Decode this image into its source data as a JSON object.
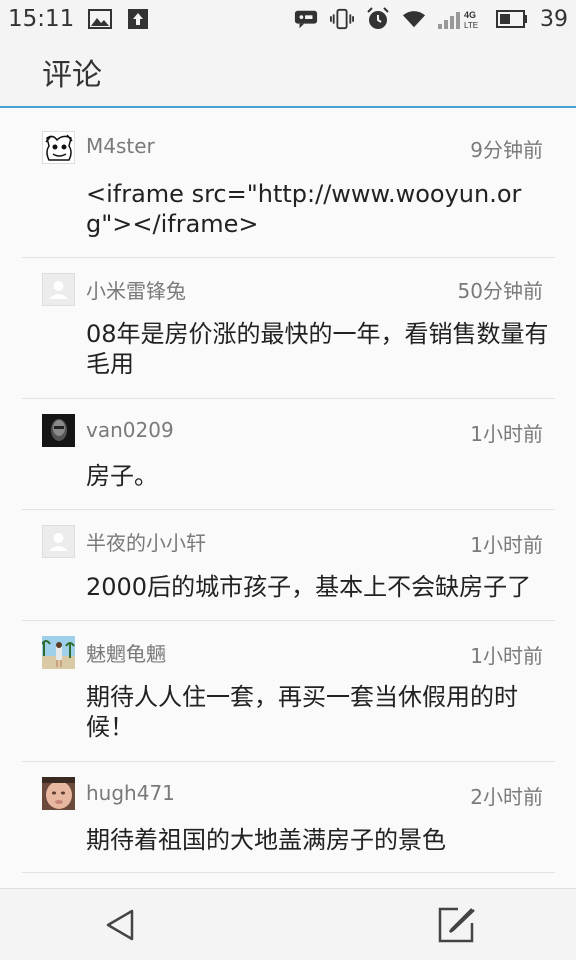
{
  "status_bar": {
    "time": "15:11",
    "battery_level": "39",
    "network": "4G LTE",
    "icons": [
      "image-icon",
      "upload-icon",
      "message-icon",
      "vibrate-icon",
      "alarm-icon",
      "wifi-icon",
      "signal-icon",
      "battery-icon"
    ]
  },
  "header": {
    "title": "评论"
  },
  "comments": [
    {
      "user": "M4ster",
      "time": "9分钟前",
      "text": "<iframe src=\"http://www.wooyun.org\"></iframe>",
      "avatar": "sketch-avatar"
    },
    {
      "user": "小米雷锋兔",
      "time": "50分钟前",
      "text": "08年是房价涨的最快的一年，看销售数量有毛用",
      "avatar": "default-avatar"
    },
    {
      "user": "van0209",
      "time": "1小时前",
      "text": "房子。",
      "avatar": "dark-portrait-avatar"
    },
    {
      "user": "半夜的小小轩",
      "time": "1小时前",
      "text": "2000后的城市孩子，基本上不会缺房子了",
      "avatar": "default-avatar"
    },
    {
      "user": "魅魍龟魎",
      "time": "1小时前",
      "text": "期待人人住一套，再买一套当休假用的时候！",
      "avatar": "beach-photo-avatar"
    },
    {
      "user": "hugh471",
      "time": "2小时前",
      "text": "期待着祖国的大地盖满房子的景色",
      "avatar": "face-photo-avatar"
    }
  ],
  "bottom_bar": {
    "icons": [
      "back-icon",
      "compose-icon"
    ]
  },
  "colors": {
    "accent_line": "#4a9fd5",
    "meta_text": "#7a7a7a",
    "divider": "#e3e3e3"
  }
}
